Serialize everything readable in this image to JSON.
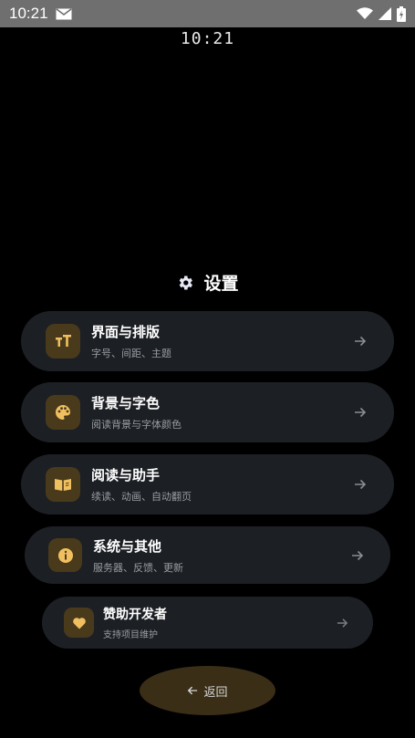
{
  "status_bar": {
    "time": "10:21",
    "icons": [
      "mail-icon",
      "wifi-icon",
      "signal-icon",
      "battery-icon"
    ]
  },
  "clock": "10:21",
  "header": {
    "icon": "gear-icon",
    "title": "设置"
  },
  "menu": [
    {
      "icon": "text-size-icon",
      "title": "界面与排版",
      "subtitle": "字号、间距、主题"
    },
    {
      "icon": "palette-icon",
      "title": "背景与字色",
      "subtitle": "阅读背景与字体颜色"
    },
    {
      "icon": "book-icon",
      "title": "阅读与助手",
      "subtitle": "续读、动画、自动翻页"
    },
    {
      "icon": "info-icon",
      "title": "系统与其他",
      "subtitle": "服务器、反馈、更新"
    },
    {
      "icon": "heart-icon",
      "title": "赞助开发者",
      "subtitle": "支持项目维护"
    }
  ],
  "back_button": {
    "icon": "arrow-left-icon",
    "label": "返回"
  },
  "colors": {
    "background": "#000000",
    "card": "#1c1f24",
    "icon_bg": "#4a3a1c",
    "accent": "#f0c060"
  }
}
